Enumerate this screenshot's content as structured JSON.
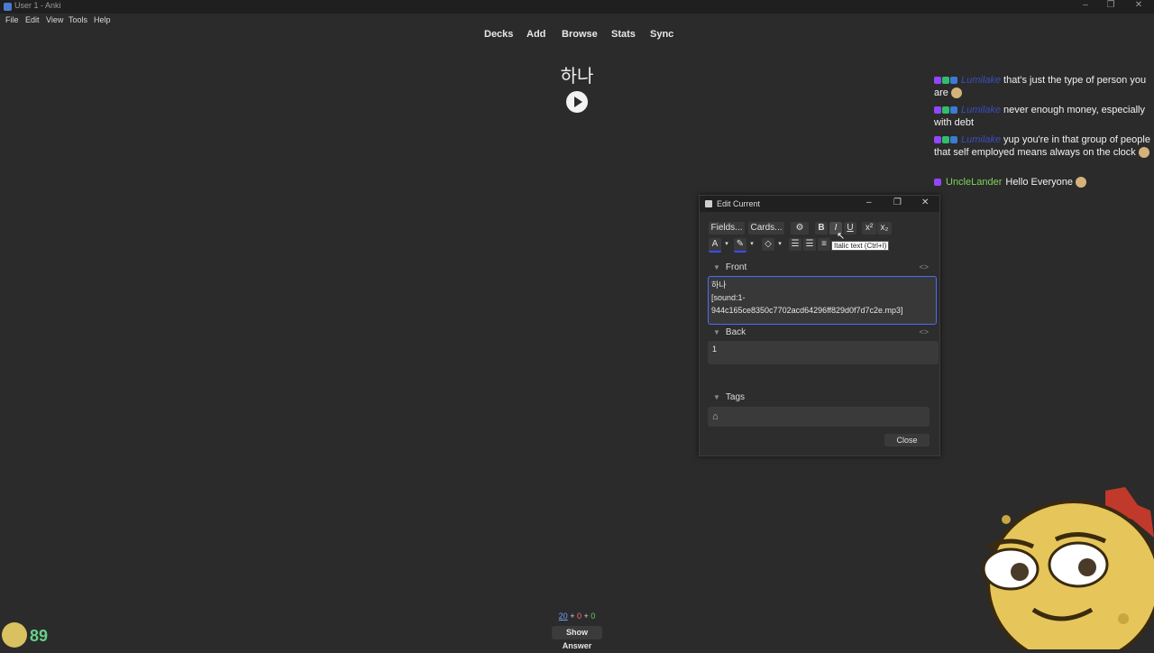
{
  "window": {
    "title": "User 1 - Anki",
    "controls": [
      "–",
      "❐",
      "✕"
    ]
  },
  "menu": [
    "File",
    "Edit",
    "View",
    "Tools",
    "Help"
  ],
  "nav": [
    "Decks",
    "Add",
    "Browse",
    "Stats",
    "Sync"
  ],
  "card": {
    "front_text": "하나"
  },
  "chat": [
    {
      "user": "Lumilake",
      "user_color": "#3a4dbb",
      "message": "that's just the type of person you are"
    },
    {
      "user": "Lumilake",
      "user_color": "#3a4dbb",
      "message": "never enough money, especially with debt"
    },
    {
      "user": "Lumilake",
      "user_color": "#3a4dbb",
      "message": "yup you're in that group of people that self employed means always on the clock"
    },
    {
      "user": "UncleLander",
      "user_color": "#7fd35a",
      "message": "Hello Everyone"
    }
  ],
  "edit_dialog": {
    "title": "Edit Current",
    "toolbar": {
      "fields": "Fields...",
      "cards": "Cards...",
      "bold": "B",
      "italic": "I",
      "underline": "U",
      "superscript": "x²",
      "subscript": "x₂",
      "text_color": "A"
    },
    "tooltip": "Italic text (Ctrl+I)",
    "fields": [
      {
        "label": "Front",
        "lines": [
          "하나",
          "[sound:1-",
          "944c165ce8350c7702acd64296ff829d0f7d7c2e.mp3]"
        ]
      },
      {
        "label": "Back",
        "value": "1"
      }
    ],
    "tags_label": "Tags",
    "close": "Close",
    "code_toggle": "<>"
  },
  "counts": {
    "new": "20",
    "learn": "0",
    "review": "0",
    "plus": "+"
  },
  "show_answer": "Show Answer",
  "overlay_number": "89",
  "colors": {
    "accent": "#4a6cf7",
    "new": "#6fa3ff",
    "learn": "#ff6b6b",
    "review": "#5fd35f"
  }
}
